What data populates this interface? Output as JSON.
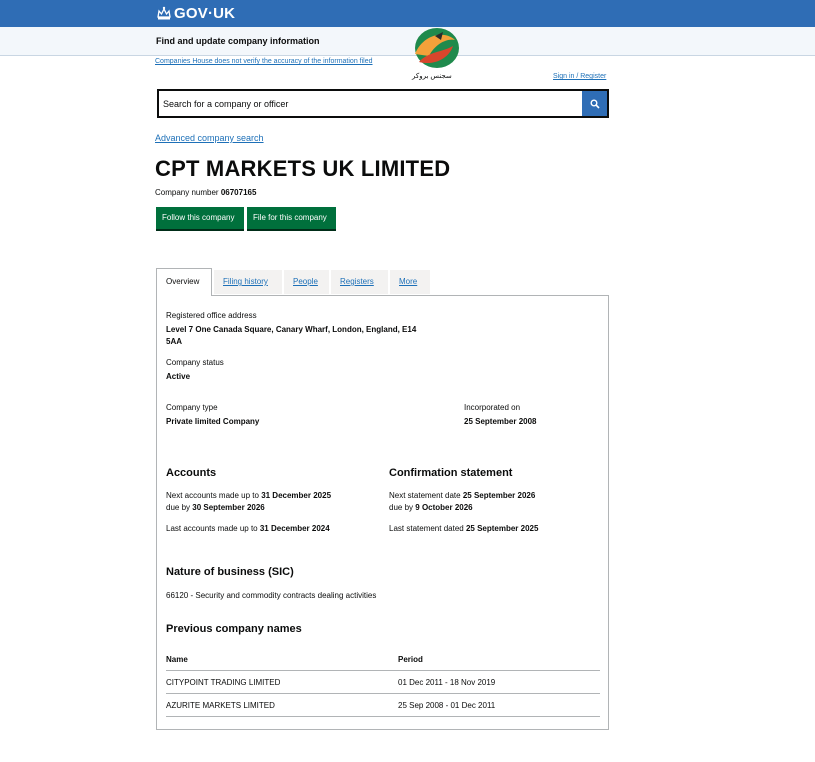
{
  "header": {
    "brand": "GOV·UK",
    "service_name": "Find and update company information",
    "disclaimer": "Companies House does not verify the accuracy of the information filed",
    "sign_in": "Sign in / Register",
    "logo_caption": "سجنس بروکر"
  },
  "search": {
    "placeholder": "Search for a company or officer",
    "advanced_link": "Advanced company search"
  },
  "company": {
    "name": "CPT MARKETS UK LIMITED",
    "number_label": "Company number",
    "number": "06707165",
    "follow_button": "Follow this company",
    "file_button": "File for this company"
  },
  "tabs": [
    "Overview",
    "Filing history",
    "People",
    "Registers",
    "More"
  ],
  "overview": {
    "address_label": "Registered office address",
    "address_line1": "Level 7 One Canada Square, Canary Wharf, London, England, E14",
    "address_line2": "5AA",
    "status_label": "Company status",
    "status": "Active",
    "type_label": "Company type",
    "type": "Private limited Company",
    "incorporated_label": "Incorporated on",
    "incorporated": "25 September 2008"
  },
  "accounts": {
    "heading": "Accounts",
    "next_prefix": "Next accounts made up to",
    "next_date": "31 December 2025",
    "due_prefix": "due by",
    "due_date": "30 September 2026",
    "last_prefix": "Last accounts made up to",
    "last_date": "31 December 2024"
  },
  "confirmation": {
    "heading": "Confirmation statement",
    "next_prefix": "Next statement date",
    "next_date": "25 September 2026",
    "due_prefix": "due by",
    "due_date": "9 October 2026",
    "last_prefix": "Last statement dated",
    "last_date": "25 September 2025"
  },
  "nature": {
    "heading": "Nature of business (SIC)",
    "sic": "66120 - Security and commodity contracts dealing activities"
  },
  "previous_names": {
    "heading": "Previous company names",
    "col_name": "Name",
    "col_period": "Period",
    "rows": [
      {
        "name": "CITYPOINT TRADING LIMITED",
        "period": "01 Dec 2011 - 18 Nov 2019"
      },
      {
        "name": "AZURITE MARKETS LIMITED",
        "period": "25 Sep 2008 - 01 Dec 2011"
      }
    ]
  },
  "colors": {
    "govuk_blue": "#2f6db5",
    "button_green": "#00703c",
    "link_blue": "#1d70b8"
  }
}
